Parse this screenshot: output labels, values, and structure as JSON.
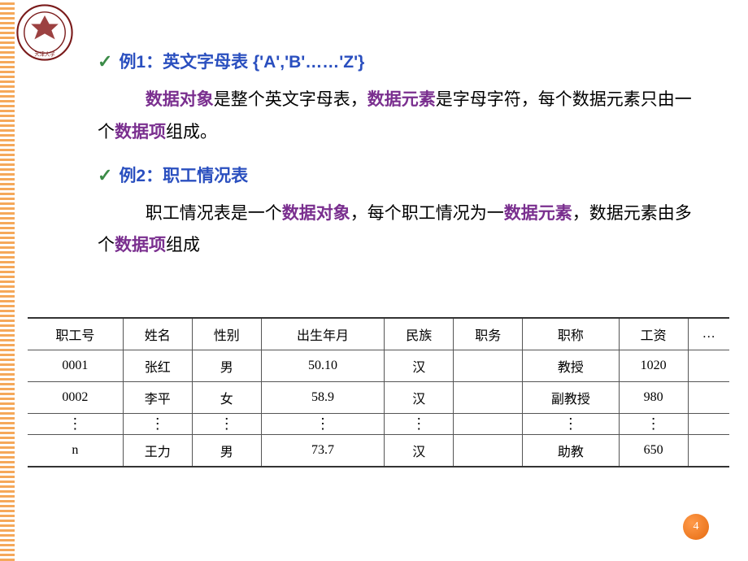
{
  "example1": {
    "label": "例1：英文字母表 {'A','B'……'Z'}",
    "para_parts": {
      "t1": "数据对象",
      "t2": "是整个英文字母表，",
      "t3": "数据元素",
      "t4": "是字母字符，每个数据元素只由一个",
      "t5": "数据项",
      "t6": "组成。"
    }
  },
  "example2": {
    "label": "例2：职工情况表",
    "para_parts": {
      "t1": "职工情况表是一个",
      "t2": "数据对象",
      "t3": "，每个职工情况为一",
      "t4": "数据元素",
      "t5": "，数据元素由多个",
      "t6": "数据项",
      "t7": "组成"
    }
  },
  "table": {
    "headers": [
      "职工号",
      "姓名",
      "性别",
      "出生年月",
      "民族",
      "职务",
      "职称",
      "工资",
      "…"
    ],
    "rows": [
      [
        "0001",
        "张红",
        "男",
        "50.10",
        "汉",
        "",
        "教授",
        "1020",
        ""
      ],
      [
        "0002",
        "李平",
        "女",
        "58.9",
        "汉",
        "",
        "副教授",
        "980",
        ""
      ],
      [
        "⋮",
        "⋮",
        "⋮",
        "⋮",
        "⋮",
        "",
        "⋮",
        "⋮",
        ""
      ],
      [
        "n",
        "王力",
        "男",
        "73.7",
        "汉",
        "",
        "助教",
        "650",
        ""
      ]
    ]
  },
  "page_number": "4"
}
